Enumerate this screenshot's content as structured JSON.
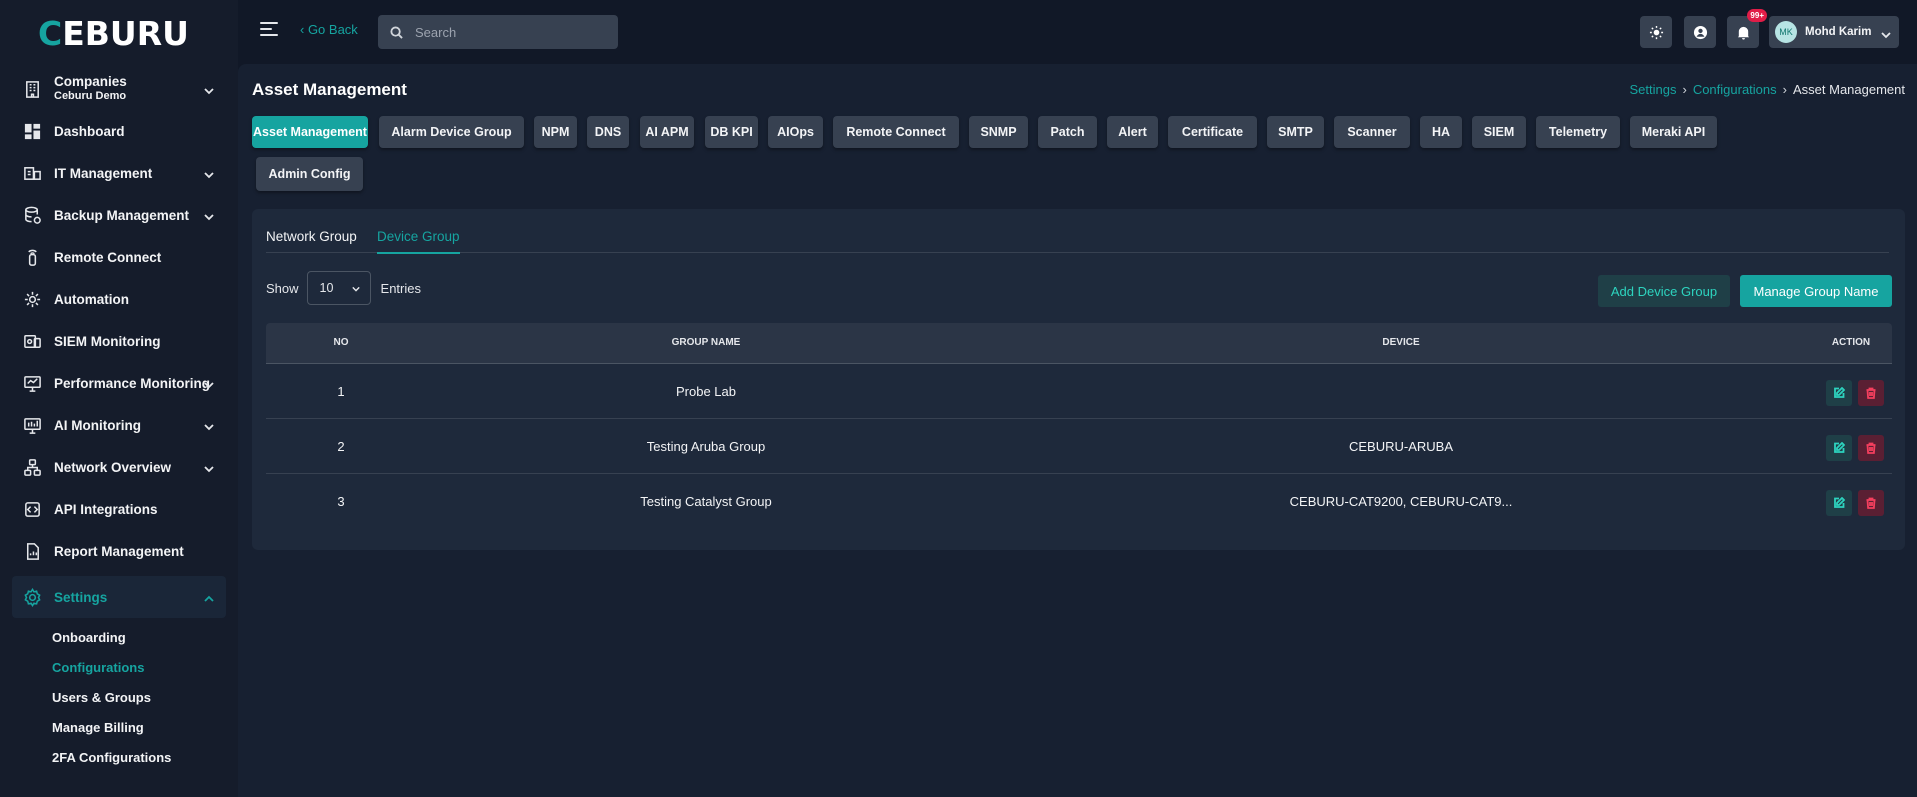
{
  "app": {
    "logo_prefix": "C",
    "logo_rest": "EBURU"
  },
  "sidebar": {
    "items": [
      {
        "label": "Companies",
        "sub": "Ceburu Demo",
        "icon": "building-icon",
        "chevron": true
      },
      {
        "label": "Dashboard",
        "icon": "dashboard-icon",
        "chevron": false
      },
      {
        "label": "IT Management",
        "icon": "it-management-icon",
        "chevron": true
      },
      {
        "label": "Backup Management",
        "icon": "backup-icon",
        "chevron": true
      },
      {
        "label": "Remote Connect",
        "icon": "remote-icon",
        "chevron": false
      },
      {
        "label": "Automation",
        "icon": "automation-gear-icon",
        "chevron": false
      },
      {
        "label": "SIEM Monitoring",
        "icon": "siem-icon",
        "chevron": false
      },
      {
        "label": "Performance Monitoring",
        "icon": "monitor-icon",
        "chevron": true
      },
      {
        "label": "AI Monitoring",
        "icon": "ai-monitor-icon",
        "chevron": true
      },
      {
        "label": "Network Overview",
        "icon": "network-icon",
        "chevron": true
      },
      {
        "label": "API Integrations",
        "icon": "api-icon",
        "chevron": false
      },
      {
        "label": "Report Management",
        "icon": "report-icon",
        "chevron": false
      },
      {
        "label": "Settings",
        "icon": "gear-icon",
        "chevron": true,
        "active": true
      }
    ],
    "settings_sub": [
      "Onboarding",
      "Configurations",
      "Users & Groups",
      "Manage Billing",
      "2FA Configurations"
    ]
  },
  "topbar": {
    "go_back": "‹ Go Back",
    "search_placeholder": "Search",
    "notif_badge": "99+",
    "user_initials": "MK",
    "user_name": "Mohd Karim"
  },
  "main": {
    "title": "Asset Management",
    "breadcrumb": [
      "Settings",
      "Configurations",
      "Asset Management"
    ],
    "tabs": [
      "Asset Management",
      "Alarm Device Group",
      "NPM",
      "DNS",
      "AI APM",
      "DB KPI",
      "AIOps",
      "Remote Connect",
      "SNMP",
      "Patch",
      "Alert",
      "Certificate",
      "SMTP",
      "Scanner",
      "HA",
      "SIEM",
      "Telemetry",
      "Meraki API",
      "Admin Config"
    ],
    "active_tab": "Asset Management"
  },
  "card": {
    "subtabs": [
      "Network Group",
      "Device Group"
    ],
    "active_subtab": "Device Group",
    "show_label": "Show",
    "entries_value": "10",
    "entries_label": "Entries",
    "add_button": "Add Device Group",
    "manage_button": "Manage Group Name",
    "columns": [
      "NO",
      "GROUP NAME",
      "DEVICE",
      "ACTION"
    ],
    "rows": [
      {
        "no": "1",
        "group": "Probe Lab",
        "device": ""
      },
      {
        "no": "2",
        "group": "Testing Aruba Group",
        "device": "CEBURU-ARUBA"
      },
      {
        "no": "3",
        "group": "Testing Catalyst Group",
        "device": "CEBURU-CAT9200, CEBURU-CAT9..."
      }
    ]
  },
  "colors": {
    "accent": "#16a4a0",
    "background": "#111827",
    "panel": "#1e293b",
    "danger": "#f43f5e"
  }
}
